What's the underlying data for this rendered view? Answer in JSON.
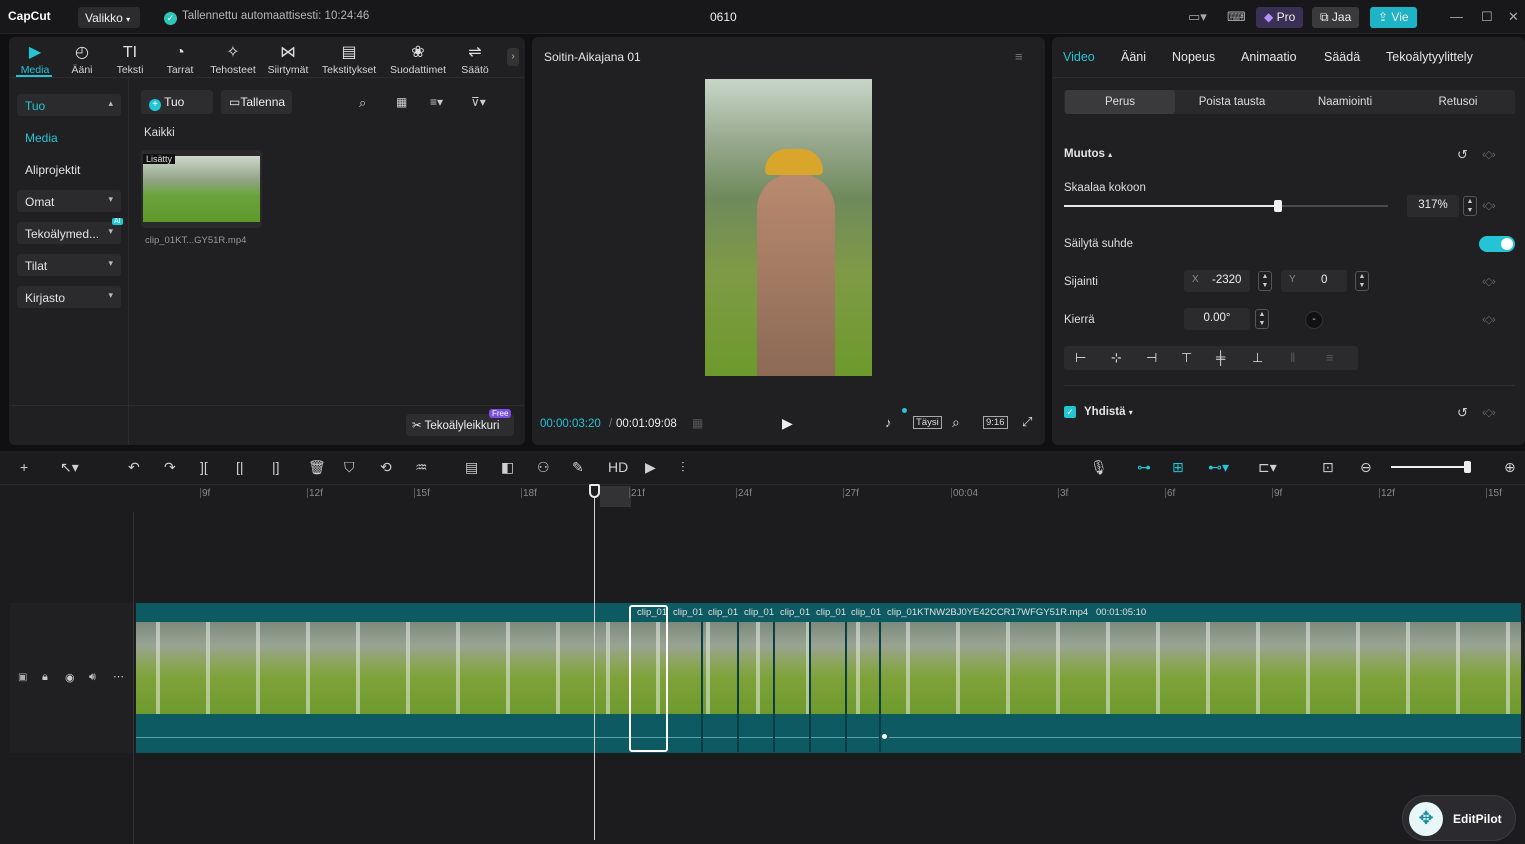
{
  "titlebar": {
    "logo": "CapCut",
    "menu": "Valikko",
    "autosave": "Tallennettu automaattisesti: 10:24:46",
    "project": "0610",
    "pro": "Pro",
    "share": "Jaa",
    "export": "Vie"
  },
  "media_toolbar": [
    {
      "label": "Media",
      "icon": "▶"
    },
    {
      "label": "Ääni",
      "icon": "◴"
    },
    {
      "label": "Teksti",
      "icon": "TI"
    },
    {
      "label": "Tarrat",
      "icon": "◔"
    },
    {
      "label": "Tehosteet",
      "icon": "✧"
    },
    {
      "label": "Siirtymät",
      "icon": "⋈"
    },
    {
      "label": "Tekstitykset",
      "icon": "▤"
    },
    {
      "label": "Suodattimet",
      "icon": "❀"
    },
    {
      "label": "Säätö",
      "icon": "⇌"
    }
  ],
  "sidebar": {
    "tuo": "Tuo",
    "media": "Media",
    "aliprojektit": "Aliprojektit",
    "omat": "Omat",
    "ai": "Tekoälymed...",
    "ai_badge": "AI",
    "tilat": "Tilat",
    "kirjasto": "Kirjasto"
  },
  "media_panel": {
    "import_btn": "Tuo",
    "record_btn": "Tallenna",
    "all_label": "Kaikki",
    "added_badge": "Lisätty",
    "clip_name": "clip_01KT...GY51R.mp4",
    "ai_cut": "Tekoälyleikkuri",
    "free_badge": "Free"
  },
  "player": {
    "title": "Soitin-Aikajana 01",
    "current_time": "00:00:03:20",
    "total_time": "00:01:09:08",
    "full_label": "Täysi",
    "ratio": "9:16"
  },
  "props": {
    "tabs": [
      "Video",
      "Ääni",
      "Nopeus",
      "Animaatio",
      "Säädä",
      "Tekoälytyylittely"
    ],
    "subtabs": [
      "Perus",
      "Poista tausta",
      "Naamiointi",
      "Retusoi"
    ],
    "section_title": "Muutos",
    "scale_label": "Skaalaa kokoon",
    "scale_value": "317%",
    "scale_fraction": 0.66,
    "keep_ratio": "Säilytä suhde",
    "position_label": "Sijainti",
    "x_label": "X",
    "x_value": "-2320",
    "y_label": "Y",
    "y_value": "0",
    "rotate_label": "Kierrä",
    "rotate_value": "0.00°",
    "blend_label": "Yhdistä"
  },
  "ruler": [
    "9f",
    "12f",
    "15f",
    "18f",
    "21f",
    "24f",
    "27f",
    "00:04",
    "3f",
    "6f",
    "9f",
    "12f",
    "15f"
  ],
  "clips": {
    "short_label": "clip_01",
    "long_label": "clip_01KTNW2BJ0YE42CCR17WFGY51R.mp4",
    "duration": "00:01:05:10"
  },
  "editpilot": "EditPilot"
}
